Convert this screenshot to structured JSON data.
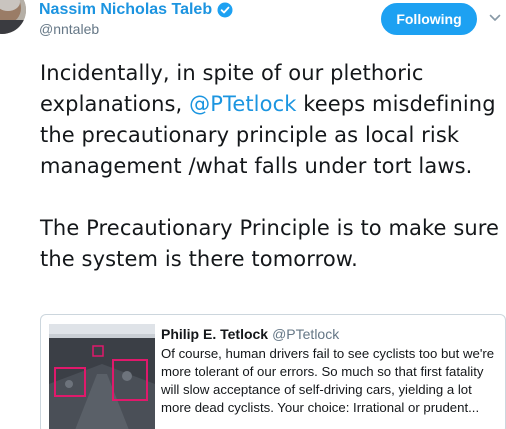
{
  "author": {
    "name": "Nassim Nicholas Taleb",
    "handle": "@nntaleb",
    "verified": true
  },
  "follow_button": {
    "label": "Following"
  },
  "tweet": {
    "paragraph1_before": "Incidentally, in spite of our plethoric explanations, ",
    "mention": "@PTetlock",
    "paragraph1_after": " keeps misdefining the precautionary principle as local risk management /what falls under tort laws.",
    "paragraph2": "The Precautionary Principle is to make sure the system is there tomorrow."
  },
  "quoted_tweet": {
    "name": "Philip E. Tetlock",
    "handle": "@PTetlock",
    "text": "Of course, human drivers fail to see cyclists too but we're more tolerant of our errors. So much so that first fatality will slow acceptance of self-driving cars,   yielding a lot more dead cyclists. Your choice: Irrational or prudent..."
  },
  "colors": {
    "accent": "#1da1f2",
    "link": "#1b95e0",
    "muted": "#657786",
    "border": "#ccd6dd"
  },
  "icons": {
    "verified": "verified-badge-icon",
    "caret": "chevron-down-icon"
  }
}
